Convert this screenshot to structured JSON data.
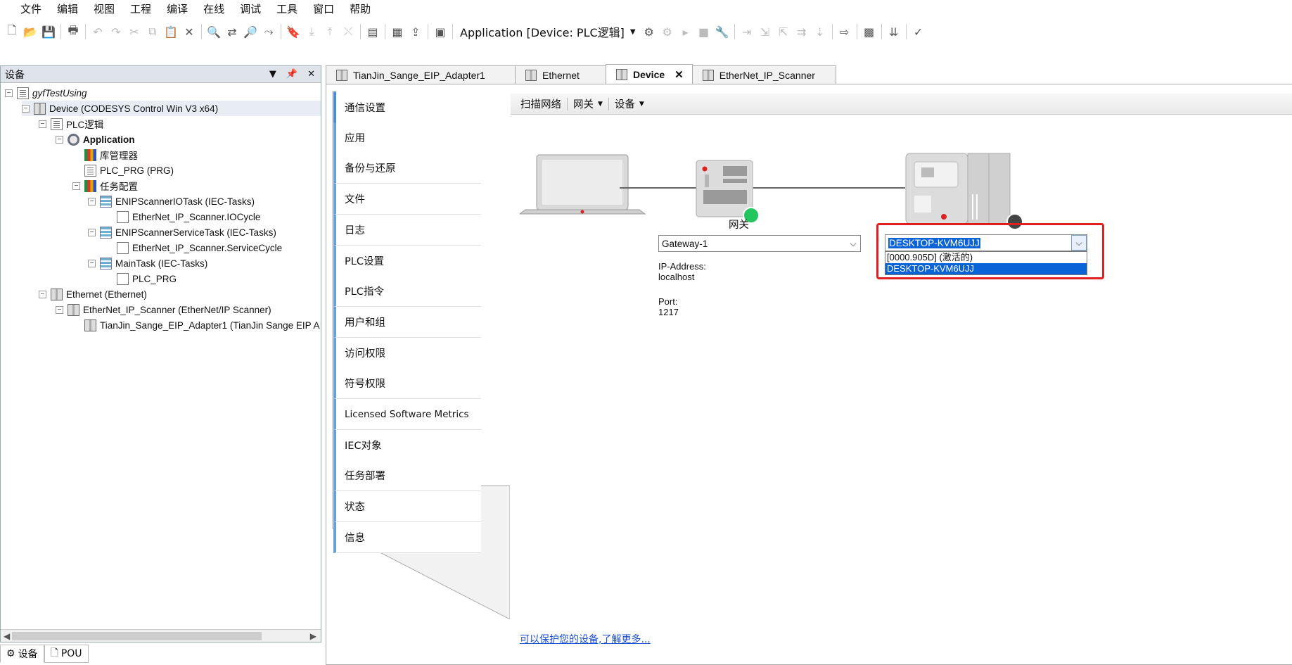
{
  "menubar": [
    "文件",
    "编辑",
    "视图",
    "工程",
    "编译",
    "在线",
    "调试",
    "工具",
    "窗口",
    "帮助"
  ],
  "toolbar": {
    "application_selector": "Application [Device: PLC逻辑]"
  },
  "left_panel": {
    "title": "设备",
    "tree": [
      {
        "label": "gyfTestUsing",
        "level": 0,
        "icon": "project-icon",
        "italic": true
      },
      {
        "label": "Device (CODESYS Control Win V3 x64)",
        "level": 1,
        "icon": "device-icon"
      },
      {
        "label": "PLC逻辑",
        "level": 2,
        "icon": "plc-logic-icon"
      },
      {
        "label": "Application",
        "level": 3,
        "icon": "application-gear-icon",
        "bold": true
      },
      {
        "label": "库管理器",
        "level": 4,
        "icon": "library-icon"
      },
      {
        "label": "PLC_PRG (PRG)",
        "level": 4,
        "icon": "program-icon"
      },
      {
        "label": "任务配置",
        "level": 4,
        "icon": "task-config-icon"
      },
      {
        "label": "ENIPScannerIOTask (IEC-Tasks)",
        "level": 5,
        "icon": "task-icon"
      },
      {
        "label": "EtherNet_IP_Scanner.IOCycle",
        "level": 6,
        "icon": "call-icon"
      },
      {
        "label": "ENIPScannerServiceTask (IEC-Tasks)",
        "level": 5,
        "icon": "task-icon"
      },
      {
        "label": "EtherNet_IP_Scanner.ServiceCycle",
        "level": 6,
        "icon": "call-icon"
      },
      {
        "label": "MainTask (IEC-Tasks)",
        "level": 5,
        "icon": "task-icon"
      },
      {
        "label": "PLC_PRG",
        "level": 6,
        "icon": "call-icon"
      },
      {
        "label": "Ethernet (Ethernet)",
        "level": 2,
        "icon": "device-icon"
      },
      {
        "label": "EtherNet_IP_Scanner (EtherNet/IP Scanner)",
        "level": 3,
        "icon": "device-icon"
      },
      {
        "label": "TianJin_Sange_EIP_Adapter1 (TianJin Sange EIP A",
        "level": 4,
        "icon": "device-icon"
      }
    ],
    "bottom_tabs": [
      "设备",
      "POU"
    ]
  },
  "editor_tabs": [
    {
      "label": "TianJin_Sange_EIP_Adapter1",
      "active": false
    },
    {
      "label": "Ethernet",
      "active": false
    },
    {
      "label": "Device",
      "active": true
    },
    {
      "label": "EtherNet_IP_Scanner",
      "active": false
    }
  ],
  "side_nav": [
    "通信设置",
    "应用",
    "备份与还原",
    "文件",
    "日志",
    "PLC设置",
    "PLC指令",
    "用户和组",
    "访问权限",
    "符号权限",
    "Licensed Software Metrics",
    "IEC对象",
    "任务部署",
    "状态",
    "信息"
  ],
  "comm_toolbar": {
    "scan": "扫描网络",
    "gateway": "网关",
    "device": "设备"
  },
  "diagram": {
    "gateway_label": "网关",
    "gateway_select": "Gateway-1",
    "ip_label": "IP-Address:",
    "ip_value": "localhost",
    "port_label": "Port:",
    "port_value": "1217",
    "device_select": "DESKTOP-KVM6UJJ",
    "device_options": [
      "[0000.905D] (激活的)",
      "DESKTOP-KVM6UJJ"
    ],
    "gateway_status_color": "#22c55e",
    "device_status_color": "#444444",
    "highlight_color": "#e02020"
  },
  "footer_link": "可以保护您的设备,了解更多..."
}
